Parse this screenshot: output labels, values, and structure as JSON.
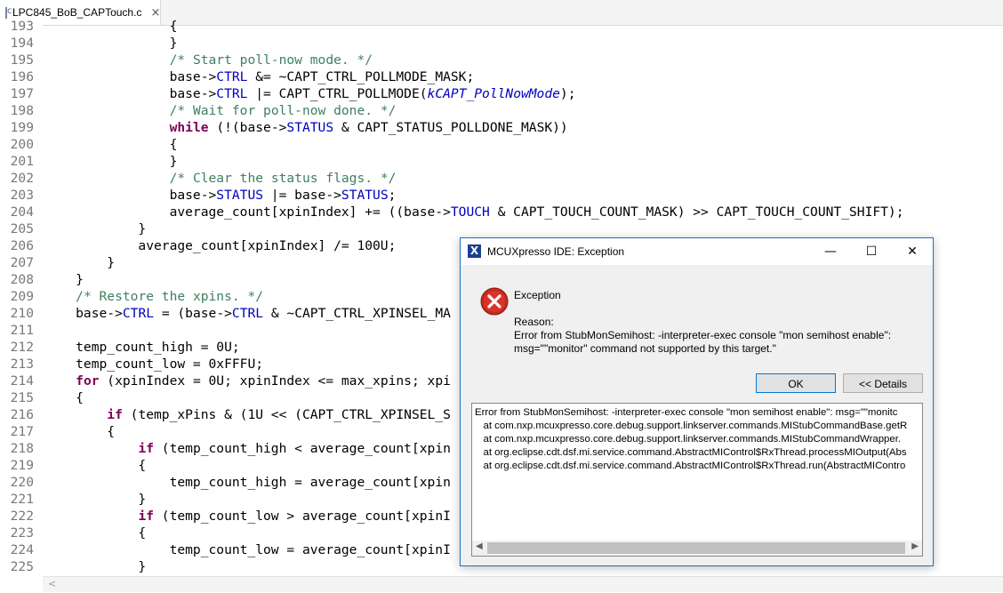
{
  "tab": {
    "label": "LPC845_BoB_CAPTouch.c",
    "close": "×"
  },
  "editor": {
    "lines": [
      {
        "n": "193",
        "html": "                {"
      },
      {
        "n": "194",
        "html": "                }"
      },
      {
        "n": "195",
        "html": "                <span class=\"cm\">/* Start poll-now mode. */</span>"
      },
      {
        "n": "196",
        "html": "                base-&gt;<span class=\"fld\">CTRL</span> &amp;= ~CAPT_CTRL_POLLMODE_MASK;"
      },
      {
        "n": "197",
        "html": "                base-&gt;<span class=\"fld\">CTRL</span> |= CAPT_CTRL_POLLMODE(<span class=\"en\">kCAPT_PollNowMode</span>);"
      },
      {
        "n": "198",
        "html": "                <span class=\"cm\">/* Wait for poll-now done. */</span>"
      },
      {
        "n": "199",
        "html": "                <span class=\"kw\">while</span> (!(base-&gt;<span class=\"fld\">STATUS</span> &amp; CAPT_STATUS_POLLDONE_MASK))"
      },
      {
        "n": "200",
        "html": "                {"
      },
      {
        "n": "201",
        "html": "                }"
      },
      {
        "n": "202",
        "html": "                <span class=\"cm\">/* Clear the status flags. */</span>"
      },
      {
        "n": "203",
        "html": "                base-&gt;<span class=\"fld\">STATUS</span> |= base-&gt;<span class=\"fld\">STATUS</span>;"
      },
      {
        "n": "204",
        "html": "                average_count[xpinIndex] += ((base-&gt;<span class=\"fld\">TOUCH</span> &amp; CAPT_TOUCH_COUNT_MASK) &gt;&gt; CAPT_TOUCH_COUNT_SHIFT);"
      },
      {
        "n": "205",
        "html": "            }"
      },
      {
        "n": "206",
        "html": "            average_count[xpinIndex] /= 100U;"
      },
      {
        "n": "207",
        "html": "        }"
      },
      {
        "n": "208",
        "html": "    }"
      },
      {
        "n": "209",
        "html": "    <span class=\"cm\">/* Restore the xpins. */</span>"
      },
      {
        "n": "210",
        "html": "    base-&gt;<span class=\"fld\">CTRL</span> = (base-&gt;<span class=\"fld\">CTRL</span> &amp; ~CAPT_CTRL_XPINSEL_MA"
      },
      {
        "n": "211",
        "html": ""
      },
      {
        "n": "212",
        "html": "    temp_count_high = 0U;"
      },
      {
        "n": "213",
        "html": "    temp_count_low = 0xFFFU;"
      },
      {
        "n": "214",
        "html": "    <span class=\"kw\">for</span> (xpinIndex = 0U; xpinIndex &lt;= max_xpins; xpi"
      },
      {
        "n": "215",
        "html": "    {"
      },
      {
        "n": "216",
        "html": "        <span class=\"kw\">if</span> (temp_xPins &amp; (1U &lt;&lt; (CAPT_CTRL_XPINSEL_S"
      },
      {
        "n": "217",
        "html": "        {"
      },
      {
        "n": "218",
        "html": "            <span class=\"kw\">if</span> (temp_count_high &lt; average_count[xpin"
      },
      {
        "n": "219",
        "html": "            {"
      },
      {
        "n": "220",
        "html": "                temp_count_high = average_count[xpin"
      },
      {
        "n": "221",
        "html": "            }"
      },
      {
        "n": "222",
        "html": "            <span class=\"kw\">if</span> (temp_count_low &gt; average_count[xpinI"
      },
      {
        "n": "223",
        "html": "            {"
      },
      {
        "n": "224",
        "html": "                temp_count_low = average_count[xpinI"
      },
      {
        "n": "225",
        "html": "            }"
      }
    ]
  },
  "dialog": {
    "title": "MCUXpresso IDE: Exception",
    "heading": "Exception",
    "reason_label": "Reason:",
    "reason_line1": "Error from StubMonSemihost: -interpreter-exec console \"mon semihost enable\":",
    "reason_line2": "msg=\"\"monitor\" command not supported by this target.\"",
    "ok_label": "OK",
    "details_label": "<< Details",
    "trace": [
      "Error from StubMonSemihost: -interpreter-exec console \"mon semihost enable\": msg=\"\"monitc",
      "   at com.nxp.mcuxpresso.core.debug.support.linkserver.commands.MIStubCommandBase.getR",
      "   at com.nxp.mcuxpresso.core.debug.support.linkserver.commands.MIStubCommandWrapper.",
      "   at org.eclipse.cdt.dsf.mi.service.command.AbstractMIControl$RxThread.processMIOutput(Abs",
      "   at org.eclipse.cdt.dsf.mi.service.command.AbstractMIControl$RxThread.run(AbstractMIContro"
    ]
  }
}
